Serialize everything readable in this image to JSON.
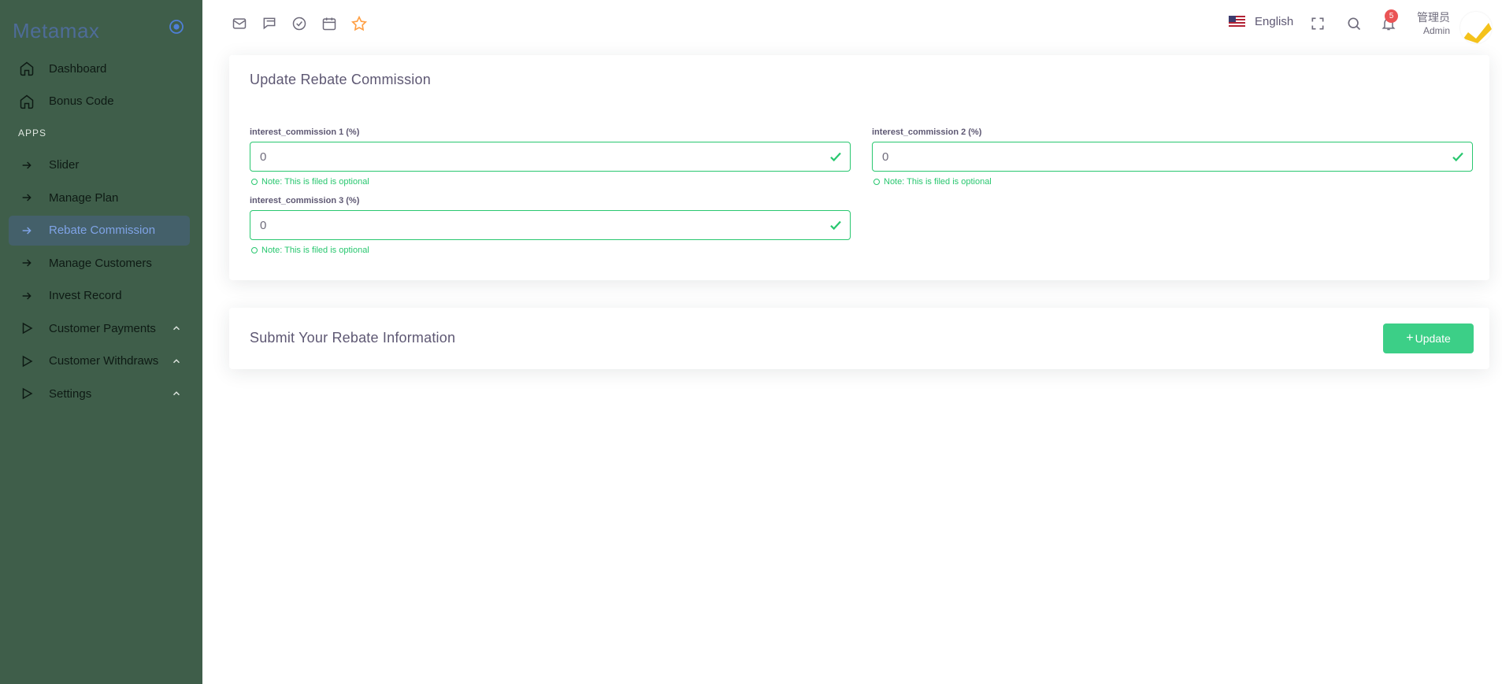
{
  "brand": {
    "name": "Metamax"
  },
  "sidebar": {
    "items": [
      {
        "label": "Dashboard"
      },
      {
        "label": "Bonus Code"
      }
    ],
    "section_header": "APPS",
    "apps": [
      {
        "label": "Slider"
      },
      {
        "label": "Manage Plan"
      },
      {
        "label": "Rebate Commission"
      },
      {
        "label": "Manage Customers"
      },
      {
        "label": "Invest Record"
      },
      {
        "label": "Customer Payments"
      },
      {
        "label": "Customer Withdraws"
      },
      {
        "label": "Settings"
      }
    ]
  },
  "header": {
    "language": "English",
    "notification_count": "5",
    "user_name": "管理员",
    "user_role": "Admin"
  },
  "form": {
    "title": "Update Rebate Commission",
    "fields": [
      {
        "label": "interest_commission 1 (%)",
        "value": "0",
        "note": "Note: This is filed is optional"
      },
      {
        "label": "interest_commission 2 (%)",
        "value": "0",
        "note": "Note: This is filed is optional"
      },
      {
        "label": "interest_commission 3 (%)",
        "value": "0",
        "note": "Note: This is filed is optional"
      }
    ]
  },
  "submit": {
    "title": "Submit Your Rebate Information",
    "button_label": "Update"
  },
  "colors": {
    "sidebar_bg": "#3f5e4a",
    "active_bg": "#44606a",
    "active_text": "#7fa3e6",
    "success": "#28c76f",
    "button": "#3ccf87",
    "badge": "#ea5455",
    "star": "#ff9f43"
  }
}
